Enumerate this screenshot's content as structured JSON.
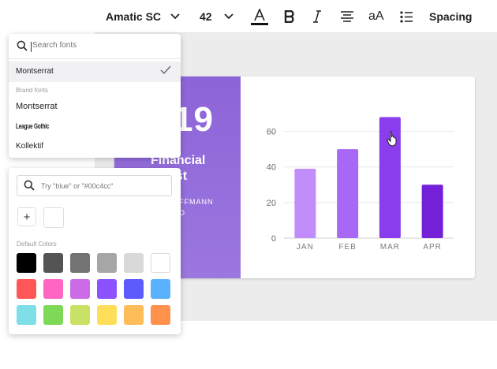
{
  "toolbar": {
    "font_name": "Amatic SC",
    "font_size": "42",
    "case_label": "aA",
    "spacing_label": "Spacing"
  },
  "slide": {
    "year": "19",
    "title_line1": "Financial",
    "title_line2": "cast",
    "name_line1": "FFMANN",
    "name_line2": "O",
    "left_color": "#9470da"
  },
  "chart_data": {
    "type": "bar",
    "categories": [
      "JAN",
      "FEB",
      "MAR",
      "APR"
    ],
    "values": [
      39,
      50,
      68,
      30
    ],
    "colors": [
      "#c18dfb",
      "#a768f5",
      "#8a3ded",
      "#7420d9"
    ],
    "yticks": [
      0,
      20,
      40,
      60
    ],
    "ylim": [
      0,
      70
    ],
    "grid": true
  },
  "font_panel": {
    "search_placeholder": "Search fonts",
    "selected_font": "Montserrat",
    "section_label": "Brand fonts",
    "items": [
      "Montserrat",
      "League Gothic",
      "Kollektif"
    ]
  },
  "color_panel": {
    "search_placeholder": "Try \"blue\" or \"#00c4cc\"",
    "add_label": "+",
    "section_label": "Default Colors",
    "swatches": [
      "#000000",
      "#545454",
      "#737373",
      "#a6a6a6",
      "#d9d9d9",
      "#ffffff",
      "#ff5757",
      "#ff66c4",
      "#cb6ce6",
      "#8c52ff",
      "#5e5bfd",
      "#5ab1fd",
      "#7fdfe9",
      "#7ed957",
      "#c9e265",
      "#ffde59",
      "#ffbd59",
      "#ff914d"
    ]
  }
}
